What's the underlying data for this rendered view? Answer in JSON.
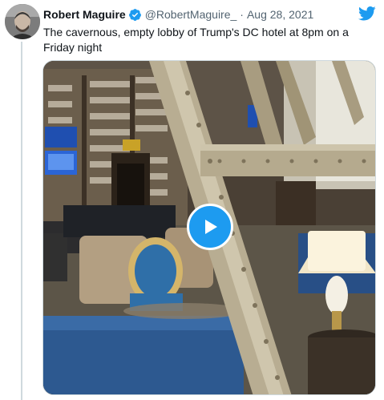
{
  "tweet": {
    "author_name": "Robert Maguire",
    "handle": "@RobertMaguire_",
    "separator": "·",
    "date": "Aug 28, 2021",
    "text": "The cavernous, empty lobby of Trump's DC hotel at 8pm on a Friday night"
  },
  "icons": {
    "verified": "verified-badge-icon",
    "brand": "twitter-bird-icon",
    "play": "play-icon"
  },
  "colors": {
    "accent": "#1d9bf0",
    "muted_text": "#536471"
  }
}
